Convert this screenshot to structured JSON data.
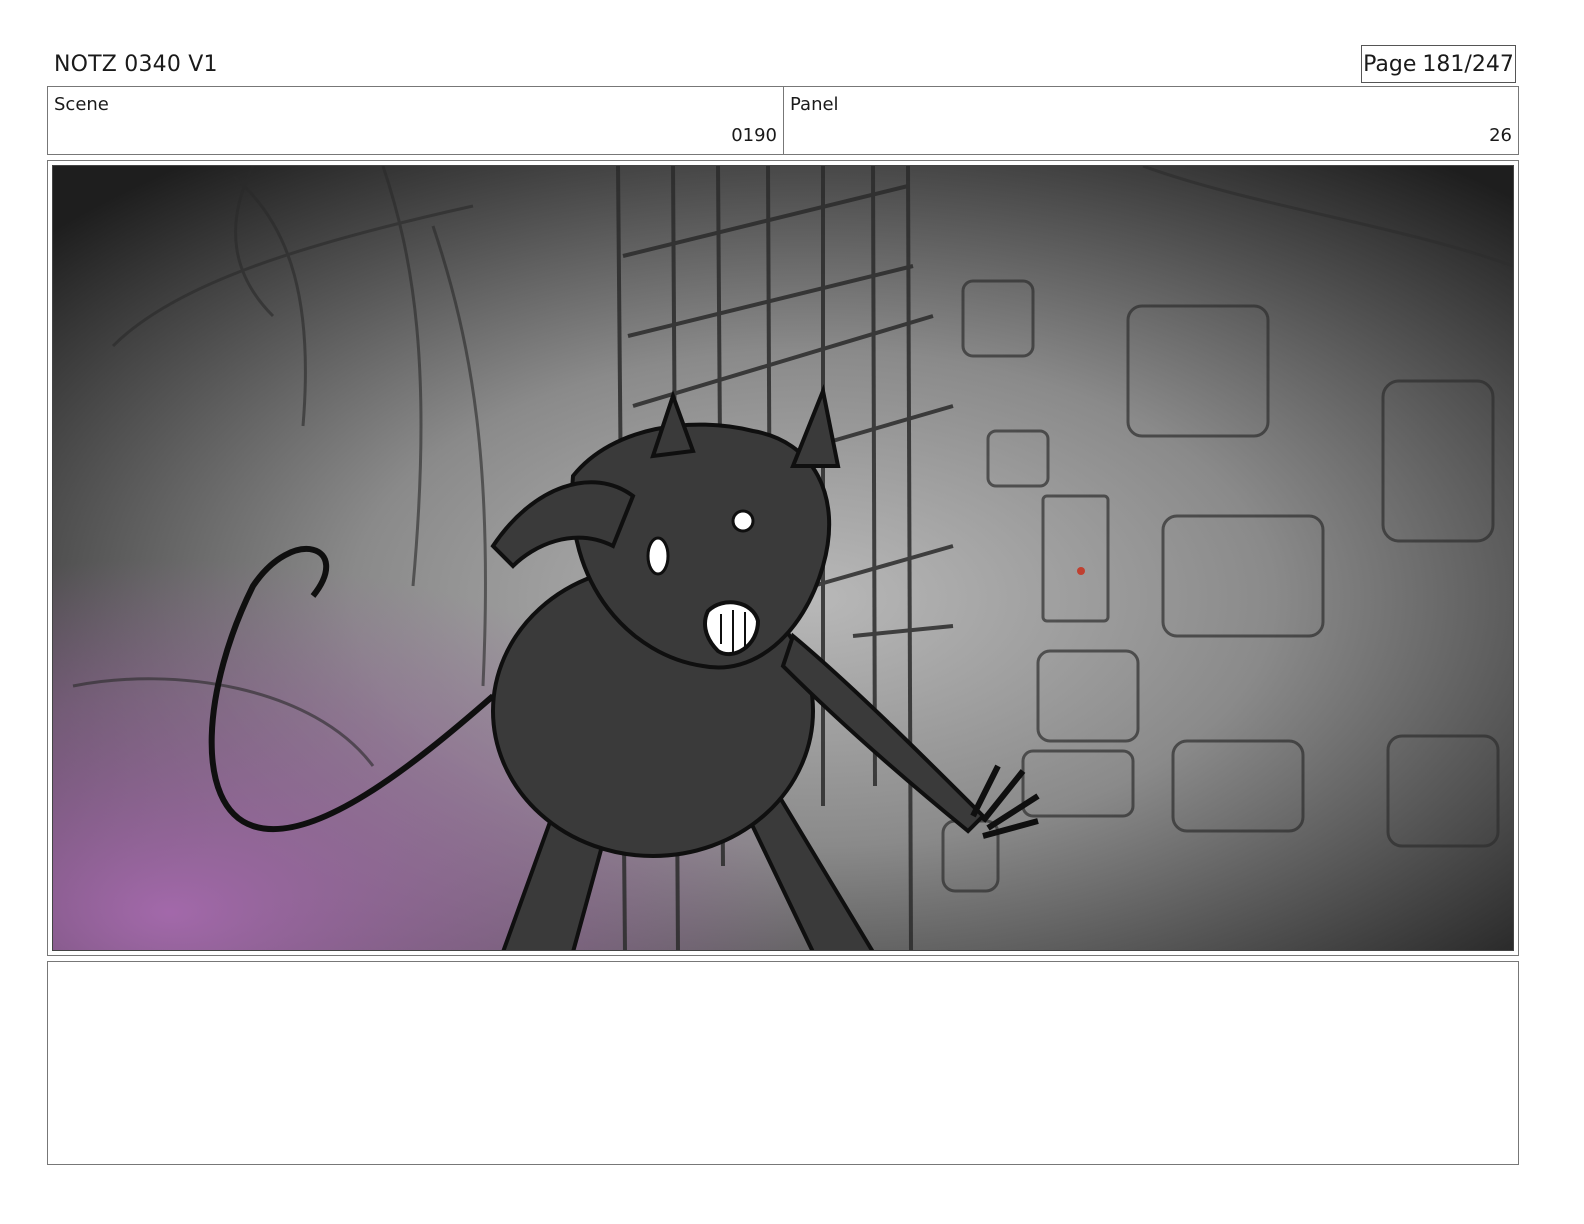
{
  "header": {
    "title": "NOTZ 0340 V1",
    "page_word": "Page",
    "page_number": "181/247"
  },
  "info": {
    "scene_label": "Scene",
    "scene_value": "0190",
    "panel_label": "Panel",
    "panel_value": "26"
  },
  "frame": {
    "icon": "storyboard-sketch-image",
    "colors": {
      "dark": "#1e1e1e",
      "mid": "#8a8a8a",
      "purple": "#a86bb0",
      "line": "#111111"
    }
  },
  "notes": {
    "text": ""
  }
}
